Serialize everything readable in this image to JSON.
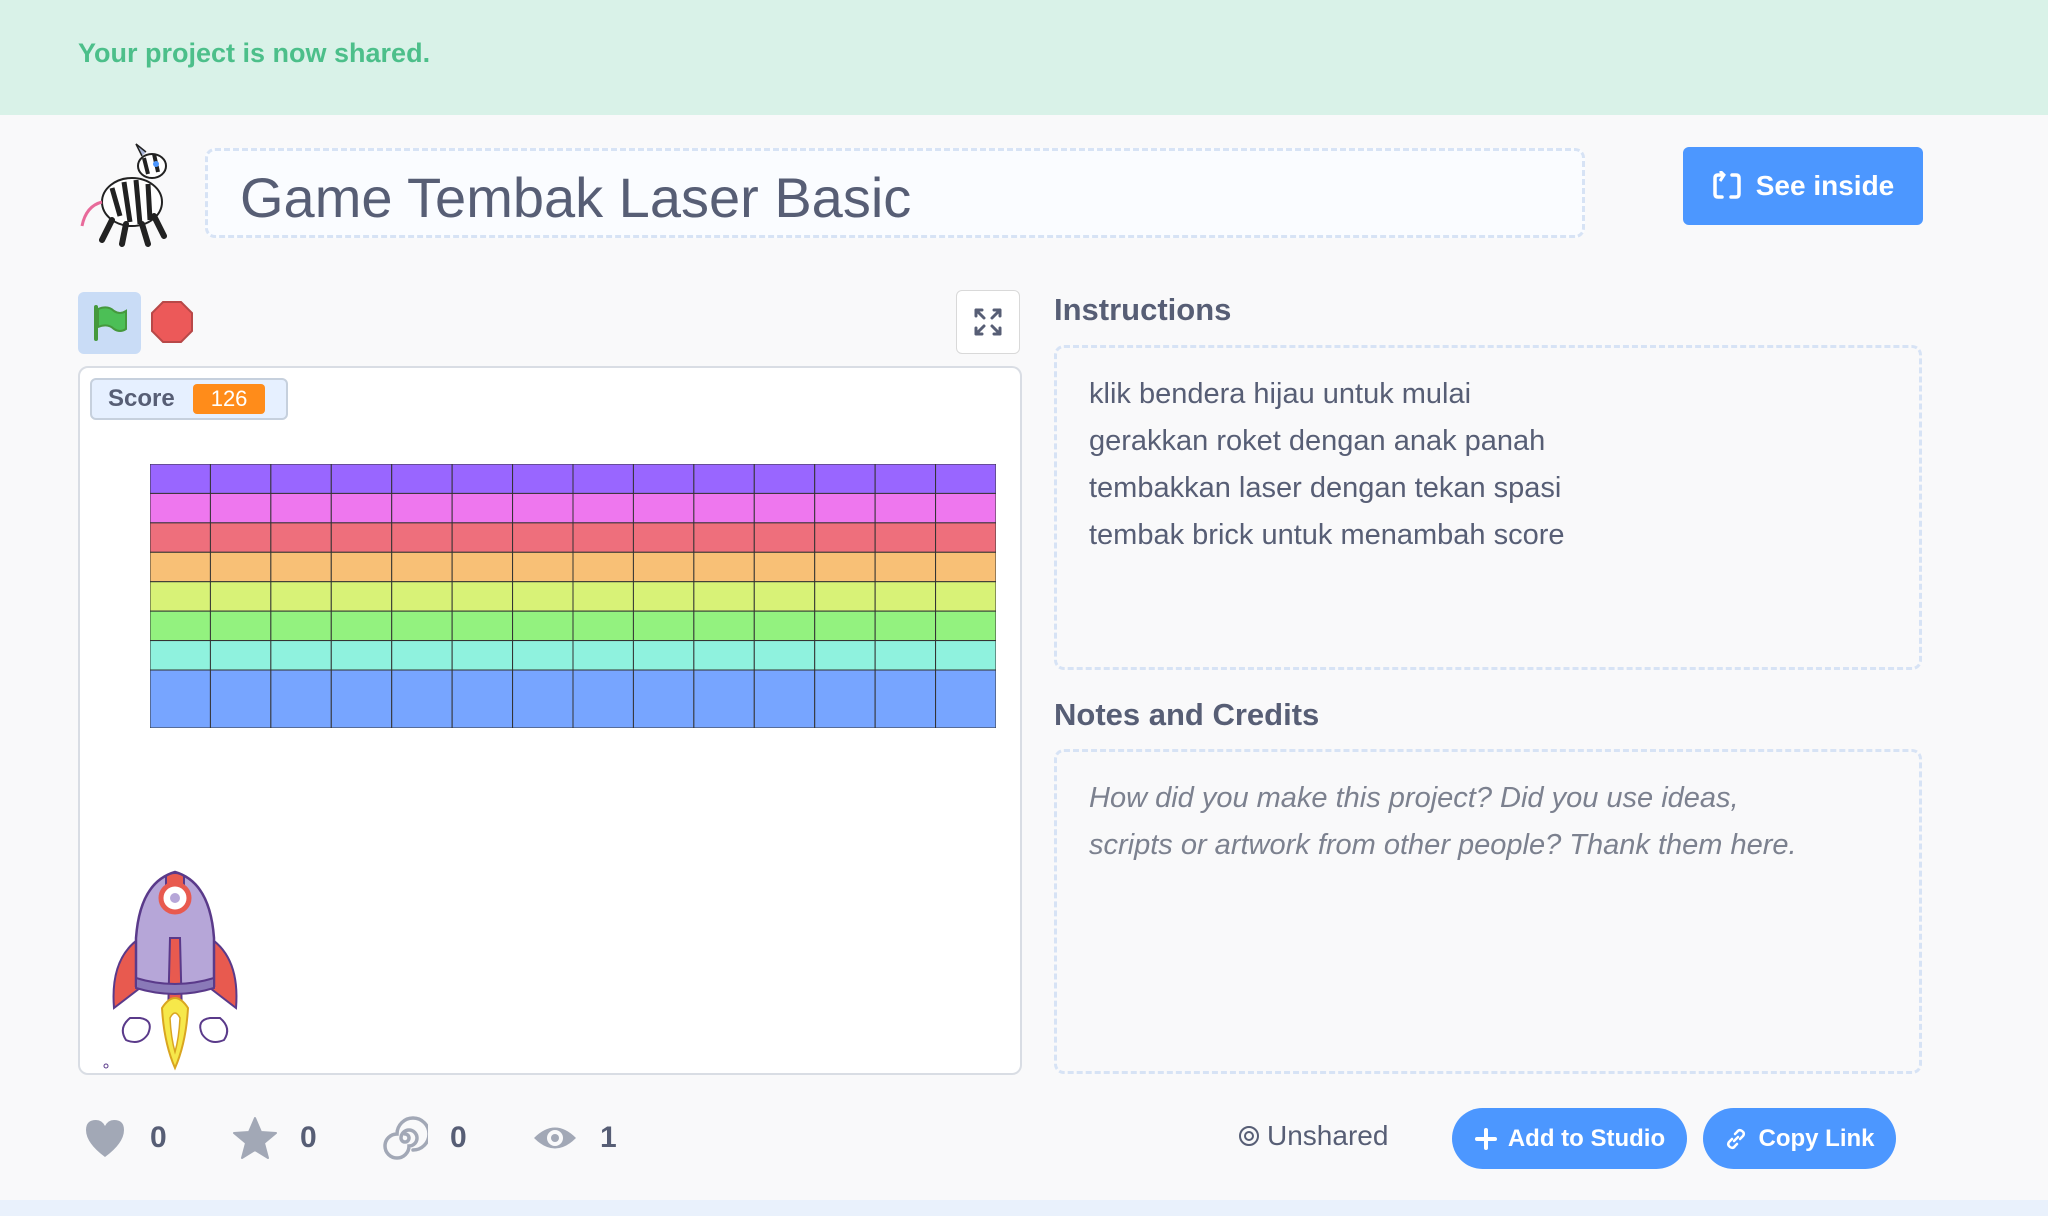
{
  "banner": {
    "message": "Your project is now shared."
  },
  "header": {
    "project_title": "Game Tembak Laser Basic",
    "see_inside_label": "See inside"
  },
  "player": {
    "score_label": "Score",
    "score_value": "126",
    "brick_rows": [
      "#9966ff",
      "#ee77ee",
      "#ee6f7c",
      "#f8c076",
      "#d8f277",
      "#93f27f",
      "#8ff2de",
      "#77a5ff"
    ],
    "brick_columns": 14
  },
  "instructions": {
    "heading": "Instructions",
    "lines": [
      "klik bendera hijau untuk mulai",
      "gerakkan roket dengan anak panah",
      "tembakkan laser dengan tekan spasi",
      "tembak brick untuk menambah score"
    ]
  },
  "notes": {
    "heading": "Notes and Credits",
    "placeholder_lines": [
      "How did you make this project? Did you use ideas,",
      "scripts or artwork from other people? Thank them here."
    ]
  },
  "stats": {
    "loves": "0",
    "favorites": "0",
    "remixes": "0",
    "views": "1"
  },
  "actions": {
    "shared_status": "Unshared",
    "add_to_studio_label": "Add to Studio",
    "copy_link_label": "Copy Link"
  },
  "colors": {
    "accent": "#4c97ff",
    "banner_bg": "#d9f2e8",
    "banner_text": "#4cbf8a",
    "score_badge": "#ff8c1a"
  }
}
